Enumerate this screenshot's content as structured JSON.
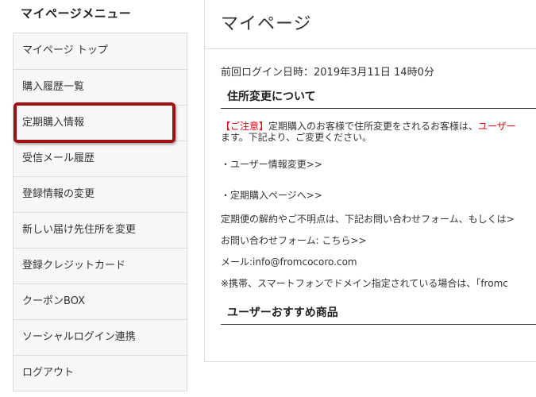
{
  "sidebar": {
    "title": "マイページメニュー",
    "items": [
      {
        "label": "マイページ トップ"
      },
      {
        "label": "購入履歴一覧"
      },
      {
        "label": "定期購入情報"
      },
      {
        "label": "受信メール履歴"
      },
      {
        "label": "登録情報の変更"
      },
      {
        "label": "新しい届け先住所を変更"
      },
      {
        "label": "登録クレジットカード"
      },
      {
        "label": "クーポンBOX"
      },
      {
        "label": "ソーシャルログイン連携"
      },
      {
        "label": "ログアウト"
      }
    ]
  },
  "main": {
    "title": "マイページ",
    "last_login": "前回ログイン日時：2019年3月11日 14時0分",
    "address_section": {
      "heading": "住所変更について",
      "notice_tag": "【ご注意】",
      "notice_text_1": "定期購入のお客様で住所変更をされるお客様は、",
      "notice_red_tail": "ユーザー",
      "notice_text_2": "ます。下記より、ご変更ください。",
      "link_user_info": "・ユーザー情報変更>>",
      "link_subscription": "・定期購入ページへ>>",
      "cancel_text": "定期便の解約やご不明点は、下記お問い合わせフォーム、もしくは>",
      "contact_form": "お問い合わせフォーム: こちら>>",
      "email": "メール:info@fromcocoro.com",
      "mobile_note": "※携帯、スマートフォンでドメイン指定されている場合は、「fromc"
    },
    "recommended_heading": "ユーザーおすすめ商品"
  },
  "colors": {
    "highlight_border": "#a10f12",
    "notice_red": "#e60012",
    "sidebar_bg": "#f7f7f7",
    "border": "#dcdcdc"
  }
}
